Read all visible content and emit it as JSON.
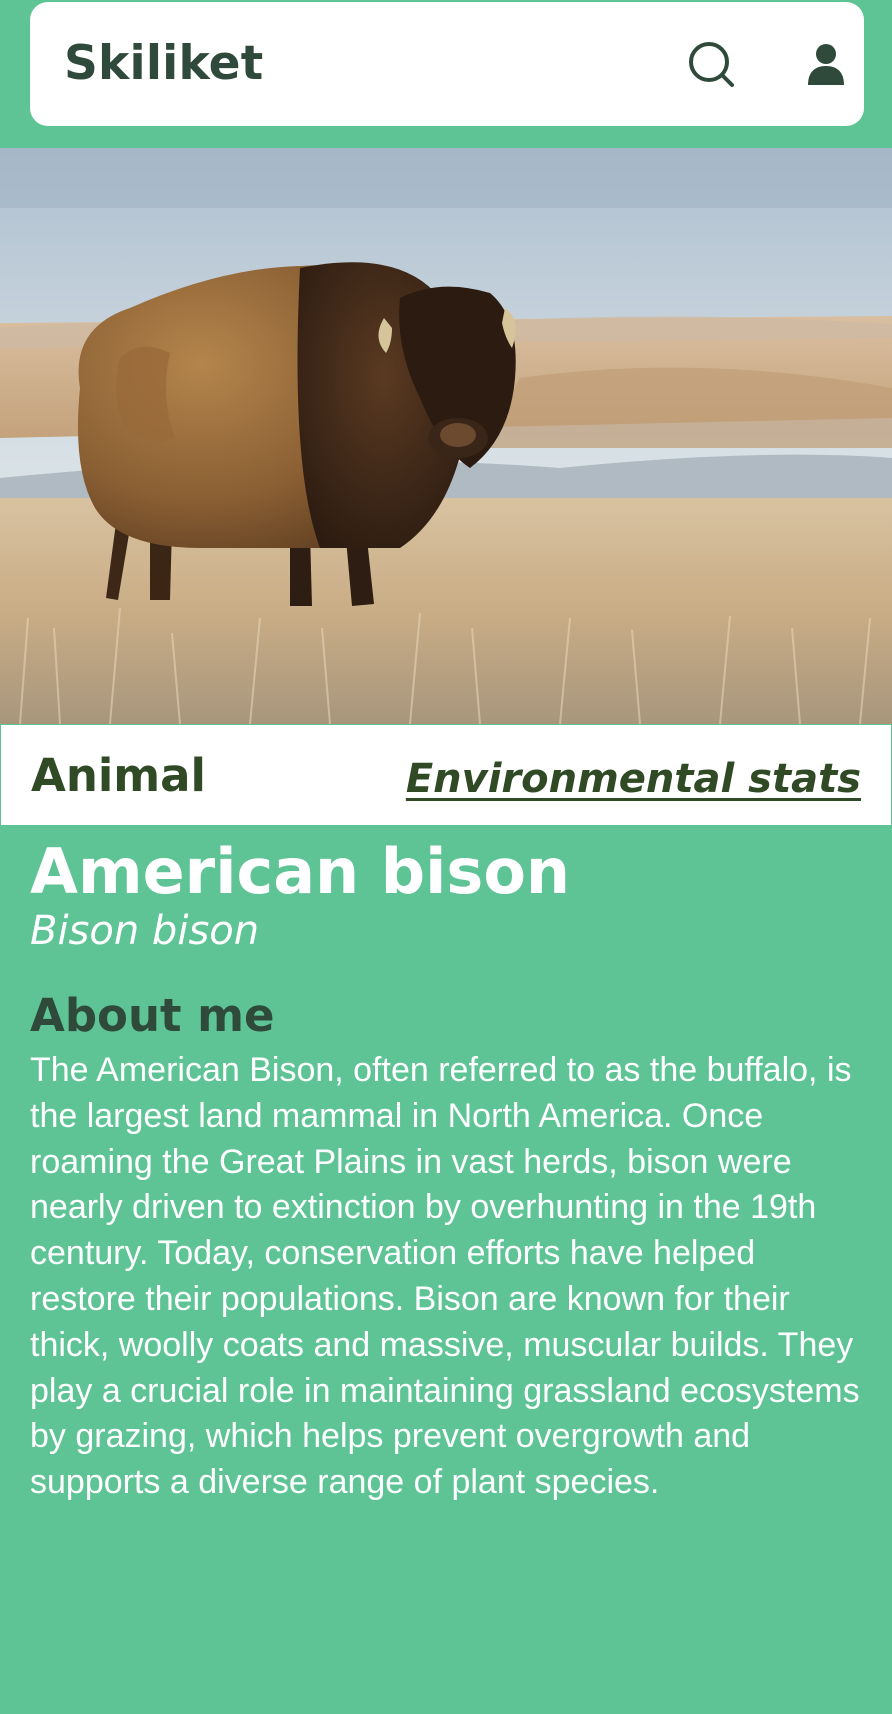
{
  "header": {
    "app_title": "Skiliket",
    "search_icon": "search-icon",
    "profile_icon": "user-icon"
  },
  "hero": {
    "image_subject": "American bison standing in golden prairie grassland"
  },
  "category_bar": {
    "category": "Animal",
    "stats_link": "Environmental  stats"
  },
  "species": {
    "common_name": "American bison",
    "scientific_name": "Bison bison"
  },
  "about": {
    "heading": "About me",
    "body": "The American Bison, often referred to as the buffalo, is the largest land mammal in North America. Once roaming the Great Plains in vast herds, bison were nearly driven to extinction by overhunting in the 19th century. Today, conservation efforts have helped restore their populations. Bison are known for their thick, woolly coats and massive, muscular builds. They play a crucial role in maintaining grassland ecosystems by grazing, which helps prevent overgrowth and supports a diverse range of plant species."
  },
  "colors": {
    "background": "#5ec496",
    "header_bg": "#ffffff",
    "title_text": "#2f4a3a",
    "category_text": "#2f4a25"
  }
}
